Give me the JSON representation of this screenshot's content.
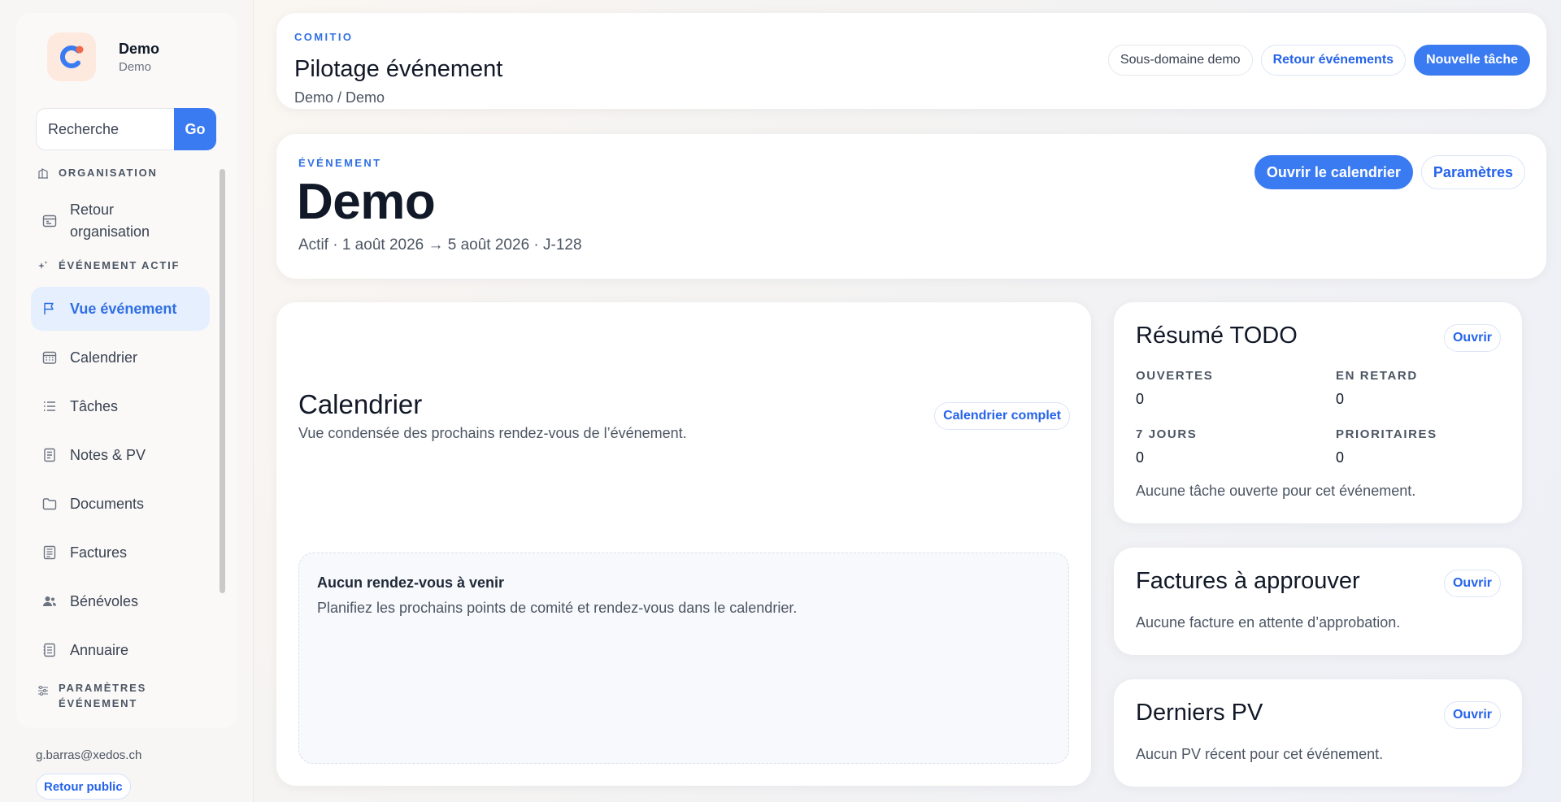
{
  "brand": {
    "name": "Demo",
    "sub": "Demo",
    "accent": "#3b7bf2",
    "logo_icon": "comitio-c-logo-icon"
  },
  "search": {
    "placeholder": "Recherche",
    "button": "Go"
  },
  "sidebar": {
    "section_org": "ORGANISATION",
    "item_back_org_line1": "Retour",
    "item_back_org_line2": "organisation",
    "section_event": "ÉVÉNEMENT ACTIF",
    "items": [
      {
        "label": "Vue événement",
        "icon": "flag-icon",
        "active": true
      },
      {
        "label": "Calendrier",
        "icon": "calendar-icon"
      },
      {
        "label": "Tâches",
        "icon": "list-icon"
      },
      {
        "label": "Notes & PV",
        "icon": "notes-icon"
      },
      {
        "label": "Documents",
        "icon": "folder-icon"
      },
      {
        "label": "Factures",
        "icon": "invoice-icon"
      },
      {
        "label": "Bénévoles",
        "icon": "users-icon"
      },
      {
        "label": "Annuaire",
        "icon": "directory-icon"
      }
    ],
    "section_settings_line1": "PARAMÈTRES",
    "section_settings_line2": "ÉVÉNEMENT"
  },
  "user": {
    "email": "g.barras@xedos.ch",
    "public_button": "Retour public"
  },
  "header": {
    "kicker": "COMITIO",
    "title": "Pilotage événement",
    "breadcrumb": "Demo / Demo",
    "actions": {
      "subdomain": "Sous-domaine demo",
      "back_events": "Retour événements",
      "new_task": "Nouvelle tâche"
    }
  },
  "event": {
    "kicker": "ÉVÉNEMENT",
    "name": "Demo",
    "meta": "Actif · 1 août 2026 → 5 août 2026 · J-128",
    "open_calendar": "Ouvrir le calendrier",
    "settings": "Paramètres"
  },
  "calendar": {
    "title": "Calendrier",
    "subtitle": "Vue condensée des prochains rendez-vous de l’événement.",
    "full_button": "Calendrier complet",
    "empty_title": "Aucun rendez-vous à venir",
    "empty_text": "Planifiez les prochains points de comité et rendez-vous dans le calendrier."
  },
  "todo": {
    "title": "Résumé TODO",
    "open_button": "Ouvrir",
    "stats": [
      {
        "label": "OUVERTES",
        "value": "0"
      },
      {
        "label": "EN RETARD",
        "value": "0"
      },
      {
        "label": "7 JOURS",
        "value": "0"
      },
      {
        "label": "PRIORITAIRES",
        "value": "0"
      }
    ],
    "empty": "Aucune tâche ouverte pour cet événement."
  },
  "invoices": {
    "title": "Factures à approuver",
    "open_button": "Ouvrir",
    "empty": "Aucune facture en attente d’approbation."
  },
  "minutes": {
    "title": "Derniers PV",
    "open_button": "Ouvrir",
    "empty": "Aucun PV récent pour cet événement."
  }
}
